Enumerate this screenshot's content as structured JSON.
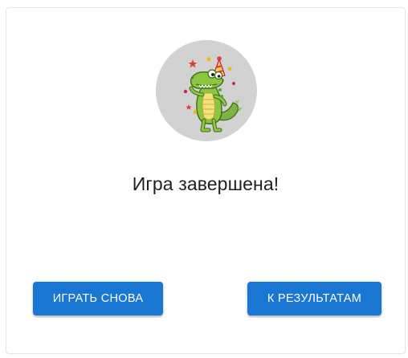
{
  "dialog": {
    "title": "Игра завершена!",
    "avatar_icon": "celebrating-crocodile-icon",
    "buttons": {
      "play_again": "ИГРАТЬ СНОВА",
      "to_results": "К РЕЗУЛЬТАТАМ"
    }
  },
  "colors": {
    "button_bg": "#1976d2",
    "avatar_bg": "#d2d2d2",
    "crocodile": "#8cc63f",
    "belly": "#f3e27a"
  }
}
